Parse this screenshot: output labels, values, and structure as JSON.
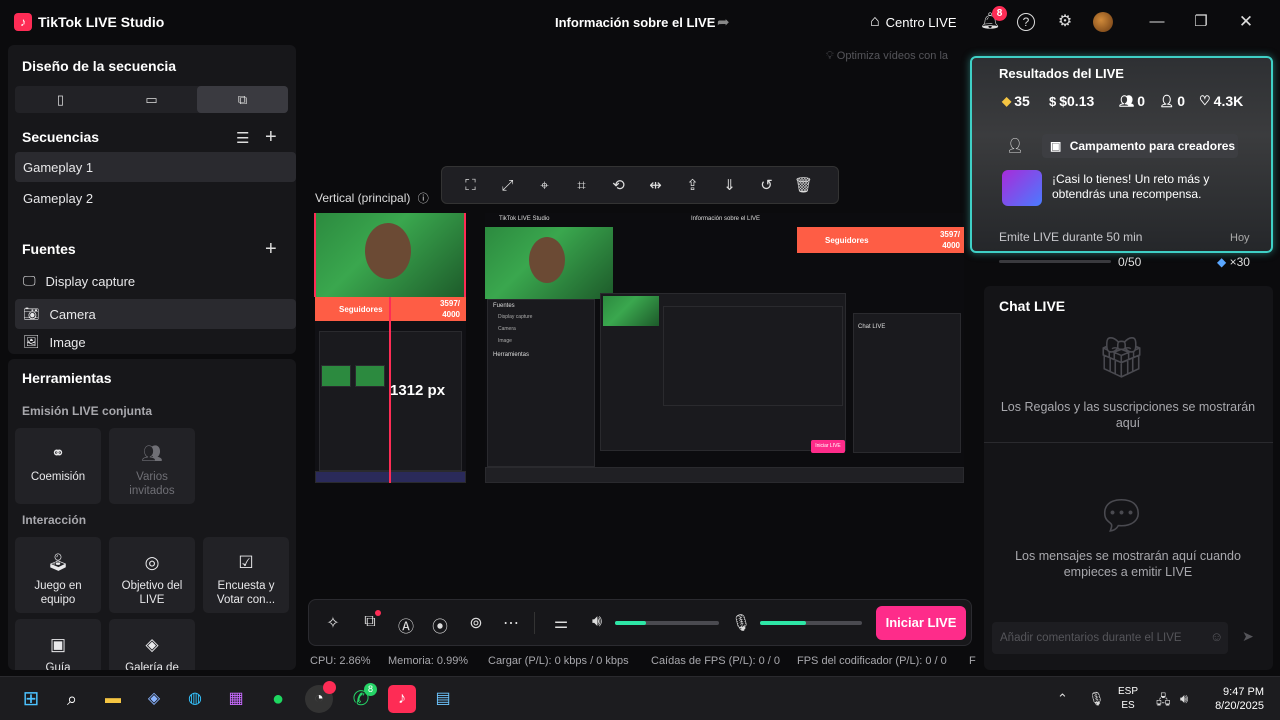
{
  "app": {
    "title": "TikTok LIVE Studio",
    "center_title": "Información sobre el LIVE",
    "centro_live": "Centro LIVE",
    "notification_count": "8"
  },
  "left": {
    "layout_title": "Diseño de la secuencia",
    "layout_options": [
      "▯",
      "▭",
      "⧉"
    ],
    "sequences_title": "Secuencias",
    "sequences": [
      "Gameplay 1",
      "Gameplay 2"
    ],
    "sources_title": "Fuentes",
    "sources": [
      "Display capture",
      "Camera",
      "Image"
    ],
    "tools_title": "Herramientas",
    "coop_label": "Emisión LIVE conjunta",
    "coop_tools": [
      "Coemisión",
      "Varios invitados"
    ],
    "interaction_label": "Interacción",
    "interaction_tools": [
      "Juego en equipo",
      "Objetivo del LIVE",
      "Encuesta y Votar con..."
    ],
    "more_tools": [
      "Guía",
      "Galería de"
    ]
  },
  "preview": {
    "hint": "Optimiza vídeos con la",
    "vertical_label": "Vertical (principal)",
    "px_label": "1312 px",
    "overlay_title": "Seguidores",
    "overlay_count": "3597/",
    "overlay_goal": "4000",
    "mini_app_title": "TikTok LIVE Studio",
    "mini_center_title": "Información sobre el LIVE",
    "mini_sources_title": "Fuentes",
    "mini_sources": [
      "Display capture",
      "Camera",
      "Image"
    ],
    "mini_tools_title": "Herramientas",
    "mini_chat_title": "Chat LIVE",
    "mini_go_live": "Iniciar LIVE"
  },
  "controls": {
    "go_live": "Iniciar LIVE",
    "speaker_level": 0.3,
    "mic_level": 0.45
  },
  "status": {
    "cpu": "CPU:  2.86%",
    "memory": "Memoria:  0.99%",
    "load": "Cargar (P/L):  0 kbps / 0 kbps",
    "fps_drops": "Caídas de FPS (P/L):  0 / 0",
    "encoder_fps": "FPS del codificador (P/L):  0 / 0",
    "trailing": "F"
  },
  "results": {
    "title": "Resultados del LIVE",
    "diamonds": "35",
    "money": "$0.13",
    "viewers": "0",
    "followers": "0",
    "likes": "4.3K",
    "campaign": "Campamento para creadores",
    "challenge": "¡Casi lo tienes! Un reto más y obtendrás una recompensa.",
    "task": "Emite LIVE durante 50 min",
    "task_when": "Hoy",
    "progress": "0/50",
    "reward": "×30"
  },
  "chat": {
    "title": "Chat LIVE",
    "gifts_empty": "Los Regalos y las suscripciones se mostrarán aquí",
    "messages_empty": "Los mensajes se mostrarán aquí cuando empieces a emitir LIVE",
    "input_placeholder": "Añadir comentarios durante el LIVE"
  },
  "taskbar": {
    "whatsapp_badge": "8",
    "lang_top": "ESP",
    "lang_bottom": "ES",
    "time": "9:47 PM",
    "date": "8/20/2025"
  },
  "colors": {
    "accent": "#fe2c55",
    "go_live": "#fe2c8a",
    "level": "#2ee6a6",
    "highlight": "#3fd0c6"
  }
}
